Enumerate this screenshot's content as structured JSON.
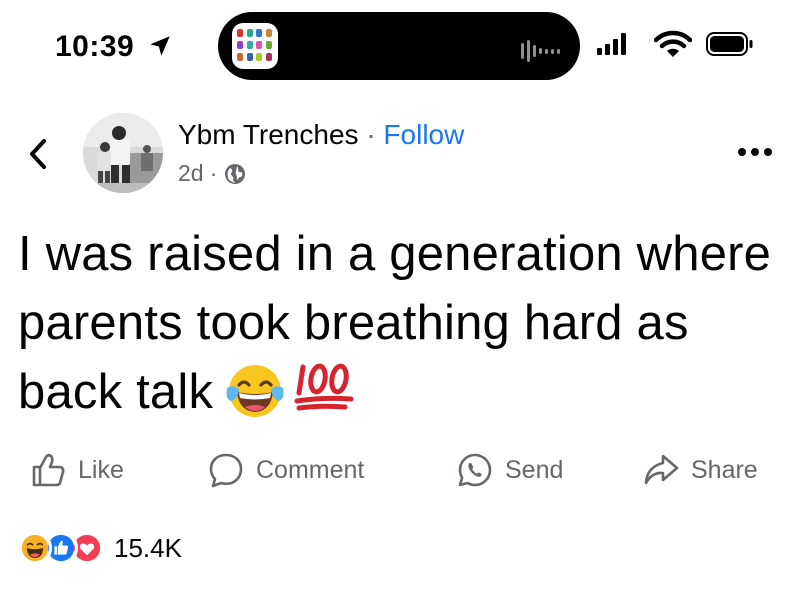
{
  "status_bar": {
    "time": "10:39",
    "icons": [
      "location-arrow-icon",
      "app-icon",
      "audio-wave-icon",
      "cellular-signal-icon",
      "wifi-icon",
      "battery-icon"
    ]
  },
  "post_header": {
    "author": "Ybm Trenches",
    "separator": "·",
    "follow_label": "Follow",
    "timestamp": "2d",
    "meta_separator": "·",
    "privacy_icon": "globe-icon"
  },
  "post": {
    "text": "I was raised in a generation where parents took breathing hard as back talk",
    "emojis": [
      "face-with-tears-of-joy",
      "hundred-points"
    ]
  },
  "actions": {
    "like": "Like",
    "comment": "Comment",
    "send": "Send",
    "share": "Share"
  },
  "reactions": {
    "types": [
      "haha",
      "like",
      "love"
    ],
    "count": "15.4K"
  },
  "colors": {
    "link": "#1877f2",
    "secondary_text": "#65676b",
    "primary_text": "#050505",
    "like_blue": "#1877f2",
    "love_red": "#f33e58",
    "haha_yellow": "#f7b125"
  }
}
